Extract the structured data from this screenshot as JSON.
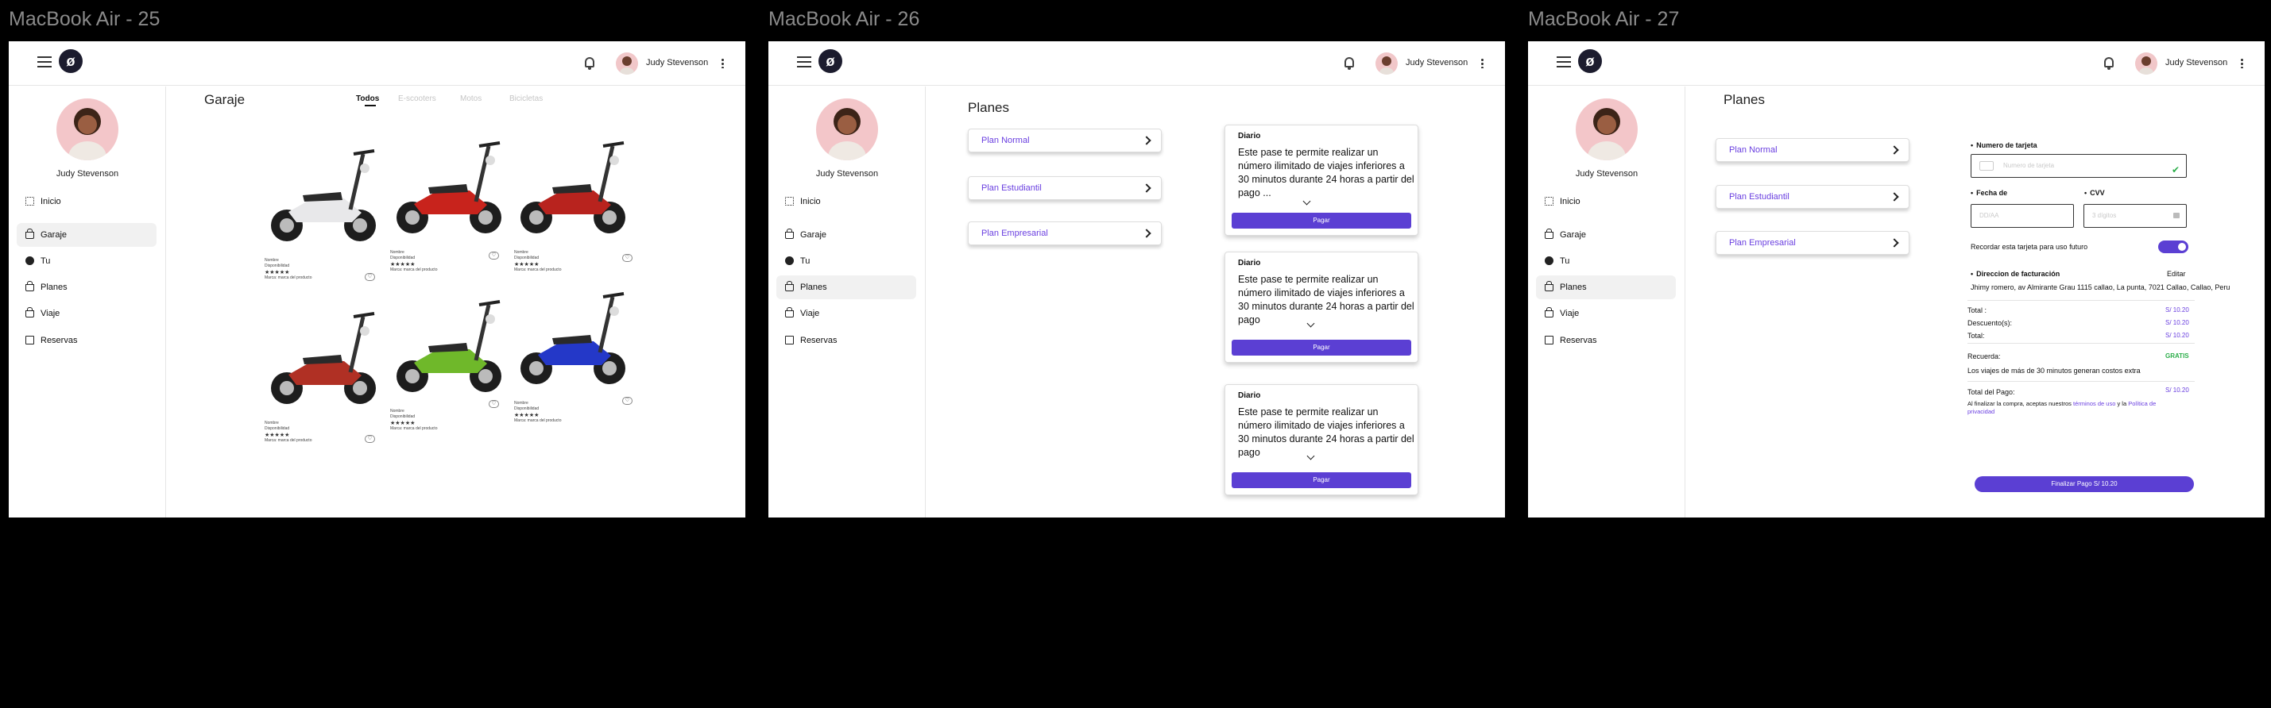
{
  "frames": [
    {
      "title": "MacBook Air - 25"
    },
    {
      "title": "MacBook Air - 26"
    },
    {
      "title": "MacBook Air - 27"
    }
  ],
  "user": {
    "name": "Judy Stevenson"
  },
  "nav": [
    "Inicio",
    "Garaje",
    "Tu",
    "Planes",
    "Viaje",
    "Reservas"
  ],
  "garaje": {
    "title": "Garaje",
    "tabs": [
      "Todos",
      "E-scooters",
      "Motos",
      "Bicicletas"
    ],
    "products": [
      {
        "name": "Nombre",
        "status": "Disponibilidad",
        "rating": "★★★★★",
        "brand": "Marca: marca del producto"
      },
      {
        "name": "Nombre",
        "status": "Disponibilidad",
        "rating": "★★★★★",
        "brand": "Marca: marca del producto"
      },
      {
        "name": "Nombre",
        "status": "Disponibilidad",
        "rating": "★★★★★",
        "brand": "Marca: marca del producto"
      },
      {
        "name": "Nombre",
        "status": "Disponibilidad",
        "rating": "★★★★★",
        "brand": "Marca: marca del producto"
      },
      {
        "name": "Nombre",
        "status": "Disponibilidad",
        "rating": "★★★★★",
        "brand": "Marca: marca del producto"
      },
      {
        "name": "Nombre",
        "status": "Disponibilidad",
        "rating": "★★★★★",
        "brand": "Marca: marca del producto"
      }
    ],
    "colors": [
      "#e8e8ea",
      "#c8231c",
      "#b8231e",
      "#b03024",
      "#6fb82a",
      "#2438c8"
    ]
  },
  "planes": {
    "title": "Planes",
    "plans": [
      "Plan Normal",
      "Plan Estudiantil",
      "Plan Empresarial"
    ],
    "cards": [
      {
        "title": "Diario",
        "desc": "Este pase te permite realizar un número ilimitado de viajes inferiores a 30 minutos durante 24 horas a partir del pago ...",
        "button": "Pagar"
      },
      {
        "title": "Diario",
        "desc": "Este pase te permite realizar un número ilimitado de viajes inferiores a 30 minutos durante 24 horas a partir del pago",
        "button": "Pagar"
      },
      {
        "title": "Diario",
        "desc": "Este pase te permite realizar un número ilimitado de viajes inferiores a 30 minutos durante 24 horas a partir del pago",
        "button": "Pagar"
      }
    ]
  },
  "pago": {
    "card_label": "Numero de tarjeta",
    "card_placeholder": "Numero de tarjeta",
    "date_label": "Fecha de",
    "date_placeholder": "DD/AA",
    "cvv_label": "CVV",
    "cvv_placeholder": "3 dígitos",
    "remember": "Recordar esta tarjeta para uso futuro",
    "billing_label": "Direccion de facturación",
    "edit": "Editar",
    "address": "Jhimy romero, av Almirante Grau 1115 callao, La punta, 7021 Callao, Callao, Peru",
    "total_label": "Total :",
    "total_value": "S/ 10.20",
    "discount_label": "Descuento(s):",
    "discount_value": "S/ 10.20",
    "total2_label": "Total:",
    "total2_value": "S/ 10.20",
    "reminder_label": "Recuerda:",
    "reminder_value": "GRATIS",
    "reminder_text": "Los viajes de más de 30 minutos generan costos extra",
    "pay_total_label": "Total del Pago:",
    "pay_total_value": "S/ 10.20",
    "terms_a": "Al finalizar la compra, aceptas nuestros",
    "terms_link1": "términos de uso",
    "terms_and": "y la",
    "terms_link2": "Política de privacidad",
    "final_button": "Finalizar Pago S/ 10.20"
  }
}
